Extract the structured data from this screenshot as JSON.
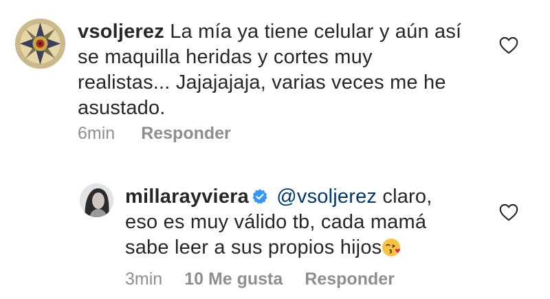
{
  "comments": [
    {
      "username": "vsoljerez",
      "text": "La mía ya tiene celular y aún así se maquilla heridas y cortes muy realistas... Jajajajaja, varias veces me he asustado.",
      "time": "6min",
      "reply_label": "Responder"
    },
    {
      "username": "millarayviera",
      "verified": true,
      "mention": "@vsoljerez",
      "text": "claro, eso es muy válido tb, cada mamá sabe leer a sus propios hijos",
      "emoji": "kissing-face-with-heart-emoji",
      "time": "3min",
      "likes_label": "10 Me gusta",
      "reply_label": "Responder"
    }
  ],
  "icons": {
    "like": "heart-outline-icon",
    "verified": "verified-badge-icon"
  },
  "colors": {
    "text": "#262626",
    "meta": "#8e8e8e",
    "mention": "#00376b",
    "verified": "#3897f0"
  }
}
